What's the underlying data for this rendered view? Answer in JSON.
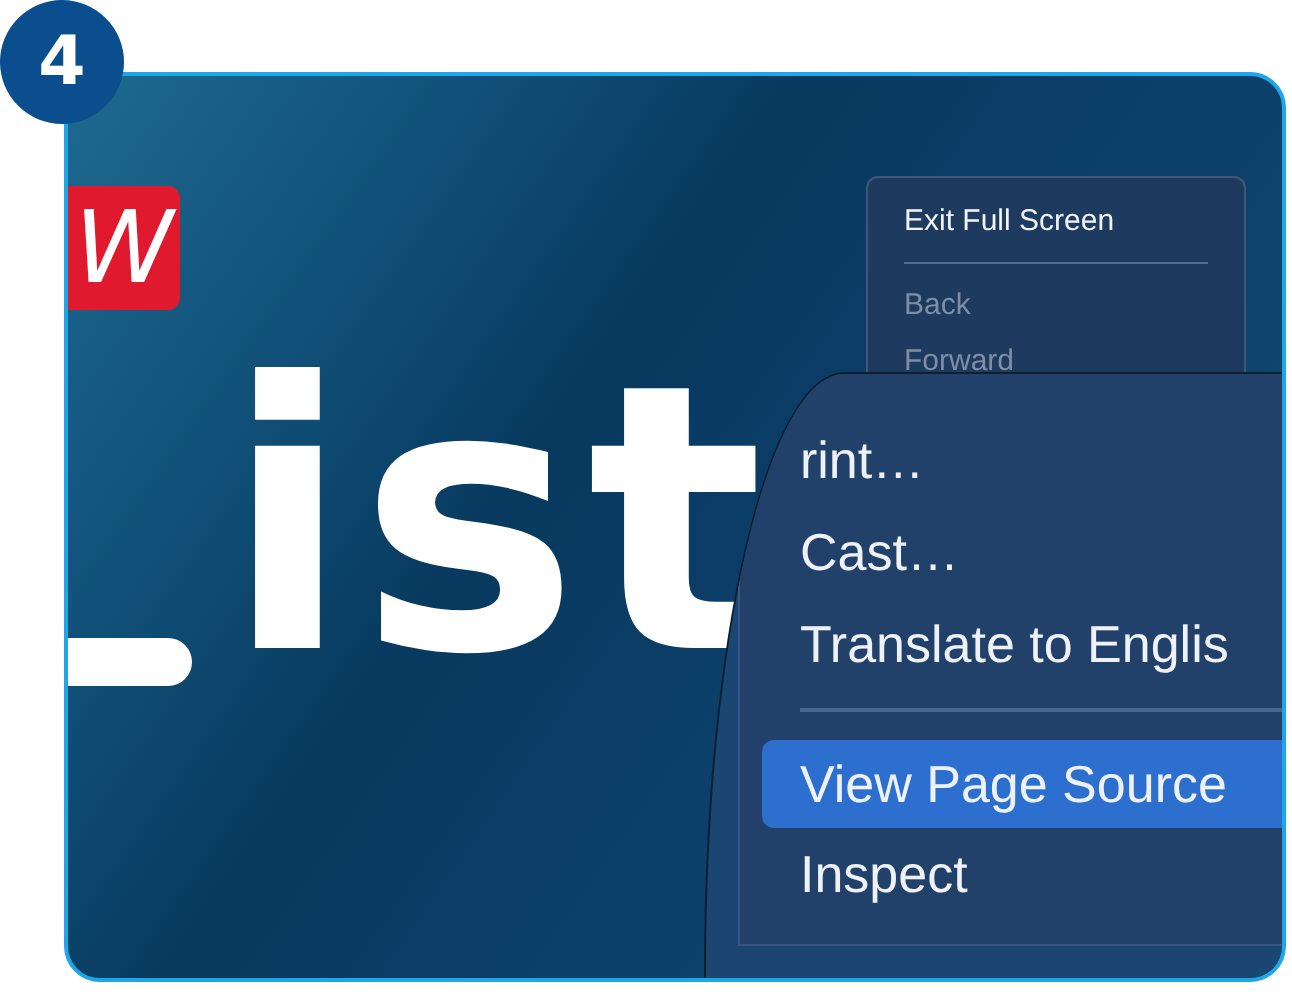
{
  "step_badge": "4",
  "logo": {
    "text": "W"
  },
  "hero_text": "ist",
  "menu": {
    "items": [
      {
        "kind": "item",
        "label": "Exit Full Screen",
        "disabled": false
      },
      {
        "kind": "separator"
      },
      {
        "kind": "item",
        "label": "Back",
        "disabled": true
      },
      {
        "kind": "item",
        "label": "Forward",
        "disabled": true
      }
    ]
  },
  "magnifier": {
    "items": [
      {
        "kind": "item",
        "label": "rint…",
        "selected": false
      },
      {
        "kind": "item",
        "label": "Cast…",
        "selected": false
      },
      {
        "kind": "item",
        "label": "Translate to Englis",
        "selected": false
      },
      {
        "kind": "separator"
      },
      {
        "kind": "item",
        "label": "View Page Source",
        "selected": true
      },
      {
        "kind": "item",
        "label": "Inspect",
        "selected": false
      }
    ]
  }
}
